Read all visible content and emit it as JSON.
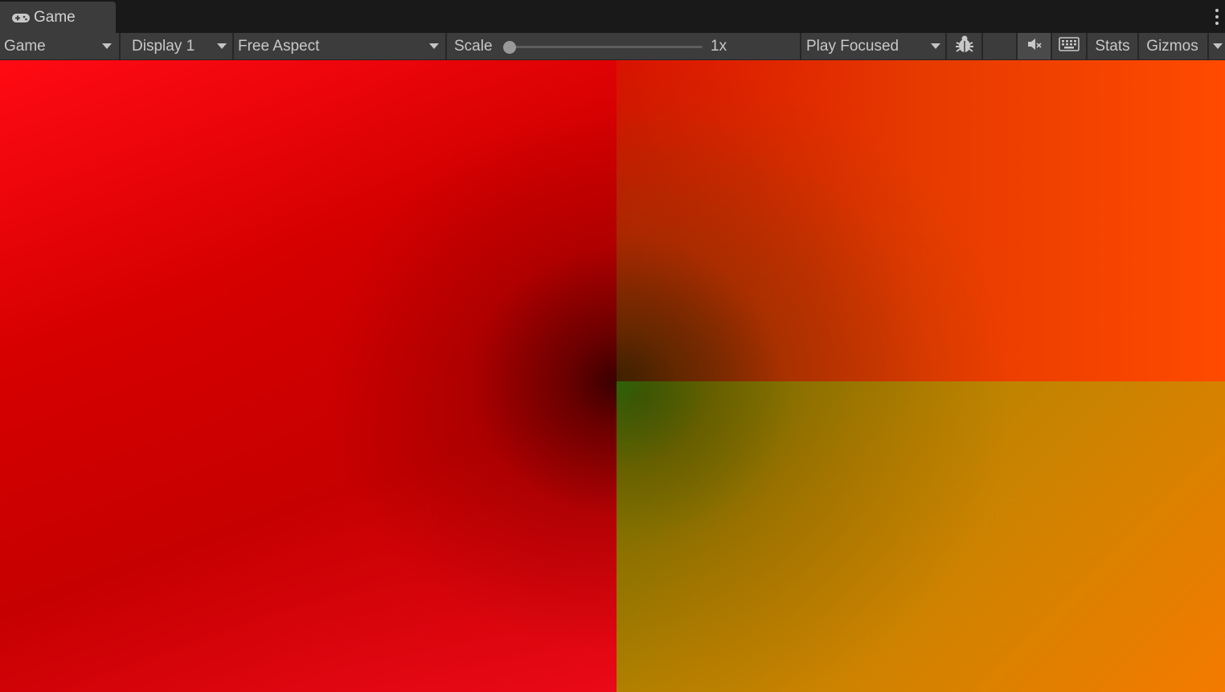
{
  "window": {
    "tab_label": "Game",
    "tab_icon": "gamepad-icon",
    "menu_icon": "kebab-menu-icon"
  },
  "toolbar": {
    "view_mode": "Game",
    "display": "Display 1",
    "aspect": "Free Aspect",
    "scale_label": "Scale",
    "scale_value": "1x",
    "scale_fraction": 0.0,
    "play_mode": "Play Focused",
    "debug_icon": "bug-icon",
    "mute_icon": "audio-mute-icon",
    "keyboard_icon": "keyboard-icon",
    "stats_label": "Stats",
    "gizmos_label": "Gizmos"
  },
  "colors": {
    "editor_bg": "#191919",
    "toolbar_bg": "#3c3c3c",
    "text": "#c8c8c8",
    "quadrant_left": "#d00000",
    "quadrant_top_right": "#e83c00",
    "quadrant_bottom_right": "#c88400",
    "center_highlight": "#1a9a12"
  }
}
